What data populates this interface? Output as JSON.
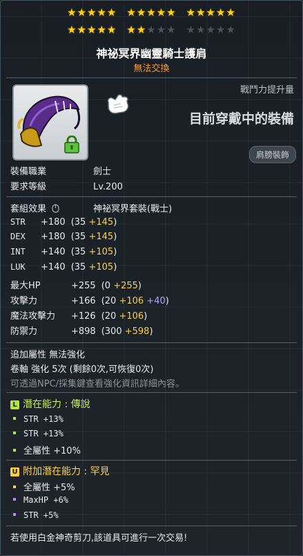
{
  "stars": {
    "filled": 22,
    "total": 30
  },
  "item": {
    "name": "神祕冥界幽靈騎士護肩",
    "trade_status": "無法交換"
  },
  "header": {
    "combat_power_label": "戰鬥力提升量",
    "equipped_text": "目前穿戴中的裝備",
    "category": "肩膀裝飾"
  },
  "requirements": {
    "job_label": "裝備職業",
    "job_value": "劍士",
    "level_label": "要求等級",
    "level_value": "Lv.200"
  },
  "set": {
    "label": "套組效果",
    "name": "神祕冥界套裝(戰士)"
  },
  "stats": [
    {
      "name": "STR",
      "total": "+180",
      "base": "(35 ",
      "bonus": "+145",
      "extra": "",
      "close": ")"
    },
    {
      "name": "DEX",
      "total": "+180",
      "base": "(35 ",
      "bonus": "+145",
      "extra": "",
      "close": ")"
    },
    {
      "name": "INT",
      "total": "+140",
      "base": "(35 ",
      "bonus": "+105",
      "extra": "",
      "close": ")"
    },
    {
      "name": "LUK",
      "total": "+140",
      "base": "(35 ",
      "bonus": "+105",
      "extra": "",
      "close": ")"
    },
    {
      "name": "最大HP",
      "total": "+255",
      "base": "(0 ",
      "bonus": "+255",
      "extra": "",
      "close": ")"
    },
    {
      "name": "攻擊力",
      "total": "+166",
      "base": "(20 ",
      "bonus": "+106",
      "extra": " +40",
      "close": ")"
    },
    {
      "name": "魔法攻擊力",
      "total": "+126",
      "base": "(20 ",
      "bonus": "+106",
      "extra": "",
      "close": ")"
    },
    {
      "name": "防禦力",
      "total": "+898",
      "base": "(300 ",
      "bonus": "+598",
      "extra": "",
      "close": ")"
    }
  ],
  "extra": {
    "bonus_attr": "追加屬性  無法強化",
    "scroll": "卷軸 強化 5次 (剩餘0次,可恢復0次)",
    "hint": "可透過NPC/採集鍵查看強化資訊詳細內容。"
  },
  "potential": {
    "badge": "L",
    "title": "潛在能力 : 傳說",
    "lines": [
      "STR +13%",
      "STR +13%",
      "全屬性 +10%"
    ]
  },
  "additional_potential": {
    "badge": "U",
    "title": "附加潛在能力 : 罕見",
    "lines": [
      "全屬性 +5%",
      "MaxHP +6%",
      "STR +5%"
    ]
  },
  "footer": "若使用白金神奇剪刀,該道具可進行一次交易!",
  "colors": {
    "trade": "#ff9a2a",
    "bonus": "#ffcf3f",
    "extra": "#a9a8ff",
    "legendary": "#b7e43a",
    "rare": "#ffcf3f"
  }
}
